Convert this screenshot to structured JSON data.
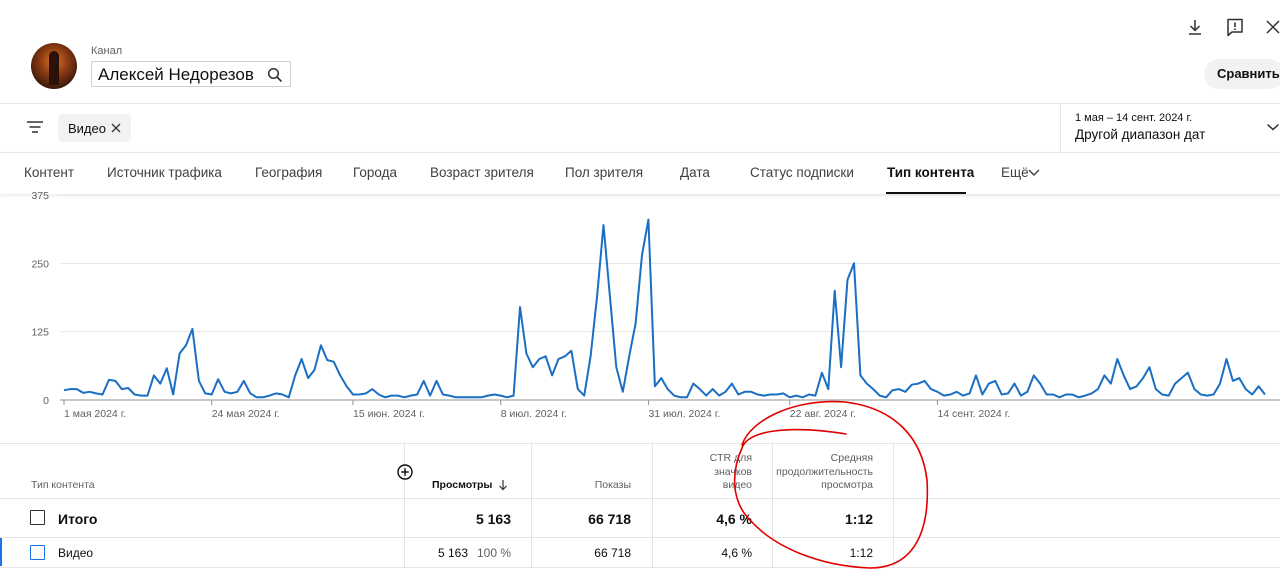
{
  "header": {
    "channel_label": "Канал",
    "channel_name": "Алексей Недорезов",
    "compare_button": "Сравнить",
    "icons": [
      "download-icon",
      "feedback-icon",
      "close-icon"
    ]
  },
  "filter_bar": {
    "chip_label": "Видео",
    "date_range": "1 мая – 14 сент. 2024 г.",
    "date_preset": "Другой диапазон дат"
  },
  "tabs": [
    {
      "label": "Контент"
    },
    {
      "label": "Источник трафика"
    },
    {
      "label": "География"
    },
    {
      "label": "Города"
    },
    {
      "label": "Возраст зрителя"
    },
    {
      "label": "Пол зрителя"
    },
    {
      "label": "Дата"
    },
    {
      "label": "Статус подписки"
    },
    {
      "label": "Тип контента",
      "active": true
    },
    {
      "label": "Ещё"
    }
  ],
  "chart_data": {
    "type": "line",
    "title": "",
    "xlabel": "",
    "ylabel": "",
    "ylim": [
      0,
      375
    ],
    "y_ticks": [
      0,
      125,
      250,
      375
    ],
    "x_tick_labels": [
      "1 мая 2024 г.",
      "24 мая 2024 г.",
      "15 июн. 2024 г.",
      "8 июл. 2024 г.",
      "31 июл. 2024 г.",
      "22 авг. 2024 г.",
      "14 сент. 2024 г."
    ],
    "x_tick_day_index": [
      0,
      23,
      45,
      68,
      91,
      113,
      136
    ],
    "series_color": "#1a6fc4",
    "series": [
      {
        "values": [
          18,
          20,
          20,
          13,
          15,
          12,
          10,
          37,
          35,
          20,
          22,
          10,
          8,
          8,
          45,
          30,
          58,
          10,
          85,
          100,
          130,
          35,
          12,
          10,
          38,
          15,
          12,
          15,
          35,
          12,
          5,
          5,
          8,
          12,
          10,
          5,
          45,
          75,
          40,
          55,
          100,
          73,
          70,
          45,
          25,
          10,
          10,
          12,
          20,
          10,
          5,
          8,
          8,
          5,
          8,
          10,
          35,
          8,
          35,
          10,
          8,
          5,
          5,
          5,
          5,
          5,
          8,
          10,
          8,
          5,
          8,
          170,
          85,
          60,
          75,
          80,
          45,
          75,
          80,
          90,
          20,
          8,
          80,
          190,
          320,
          190,
          60,
          15,
          80,
          140,
          265,
          330,
          25,
          40,
          20,
          8,
          5,
          5,
          30,
          20,
          8,
          20,
          8,
          15,
          30,
          10,
          15,
          15,
          10,
          8,
          10,
          10,
          12,
          5,
          8,
          5,
          10,
          8,
          50,
          20,
          200,
          60,
          220,
          250,
          45,
          30,
          20,
          8,
          5,
          18,
          20,
          15,
          28,
          30,
          35,
          20,
          15,
          8,
          10,
          15,
          8,
          12,
          45,
          10,
          30,
          35,
          10,
          12,
          30,
          8,
          15,
          45,
          30,
          10,
          10,
          5,
          10,
          10,
          5,
          8,
          12,
          20,
          45,
          30,
          75,
          45,
          20,
          25,
          40,
          60,
          20,
          10,
          8,
          30,
          40,
          50,
          20,
          10,
          8,
          10,
          30,
          75,
          35,
          40,
          20,
          10,
          25,
          10
        ]
      }
    ]
  },
  "table": {
    "headers": {
      "type": "Тип контента",
      "views": "Просмотры",
      "impressions": "Показы",
      "ctr_l1": "CTR для",
      "ctr_l2": "значков",
      "ctr_l3": "видео",
      "avd_l1": "Средняя",
      "avd_l2": "продолжительность",
      "avd_l3": "просмотра"
    },
    "total": {
      "label": "Итого",
      "views": "5 163",
      "impressions": "66 718",
      "ctr": "4,6 %",
      "avd": "1:12"
    },
    "rows": [
      {
        "label": "Видео",
        "views": "5 163",
        "views_pct": "100 %",
        "impressions": "66 718",
        "ctr": "4,6 %",
        "avd": "1:12"
      }
    ]
  },
  "annotation_color": "#e00000"
}
